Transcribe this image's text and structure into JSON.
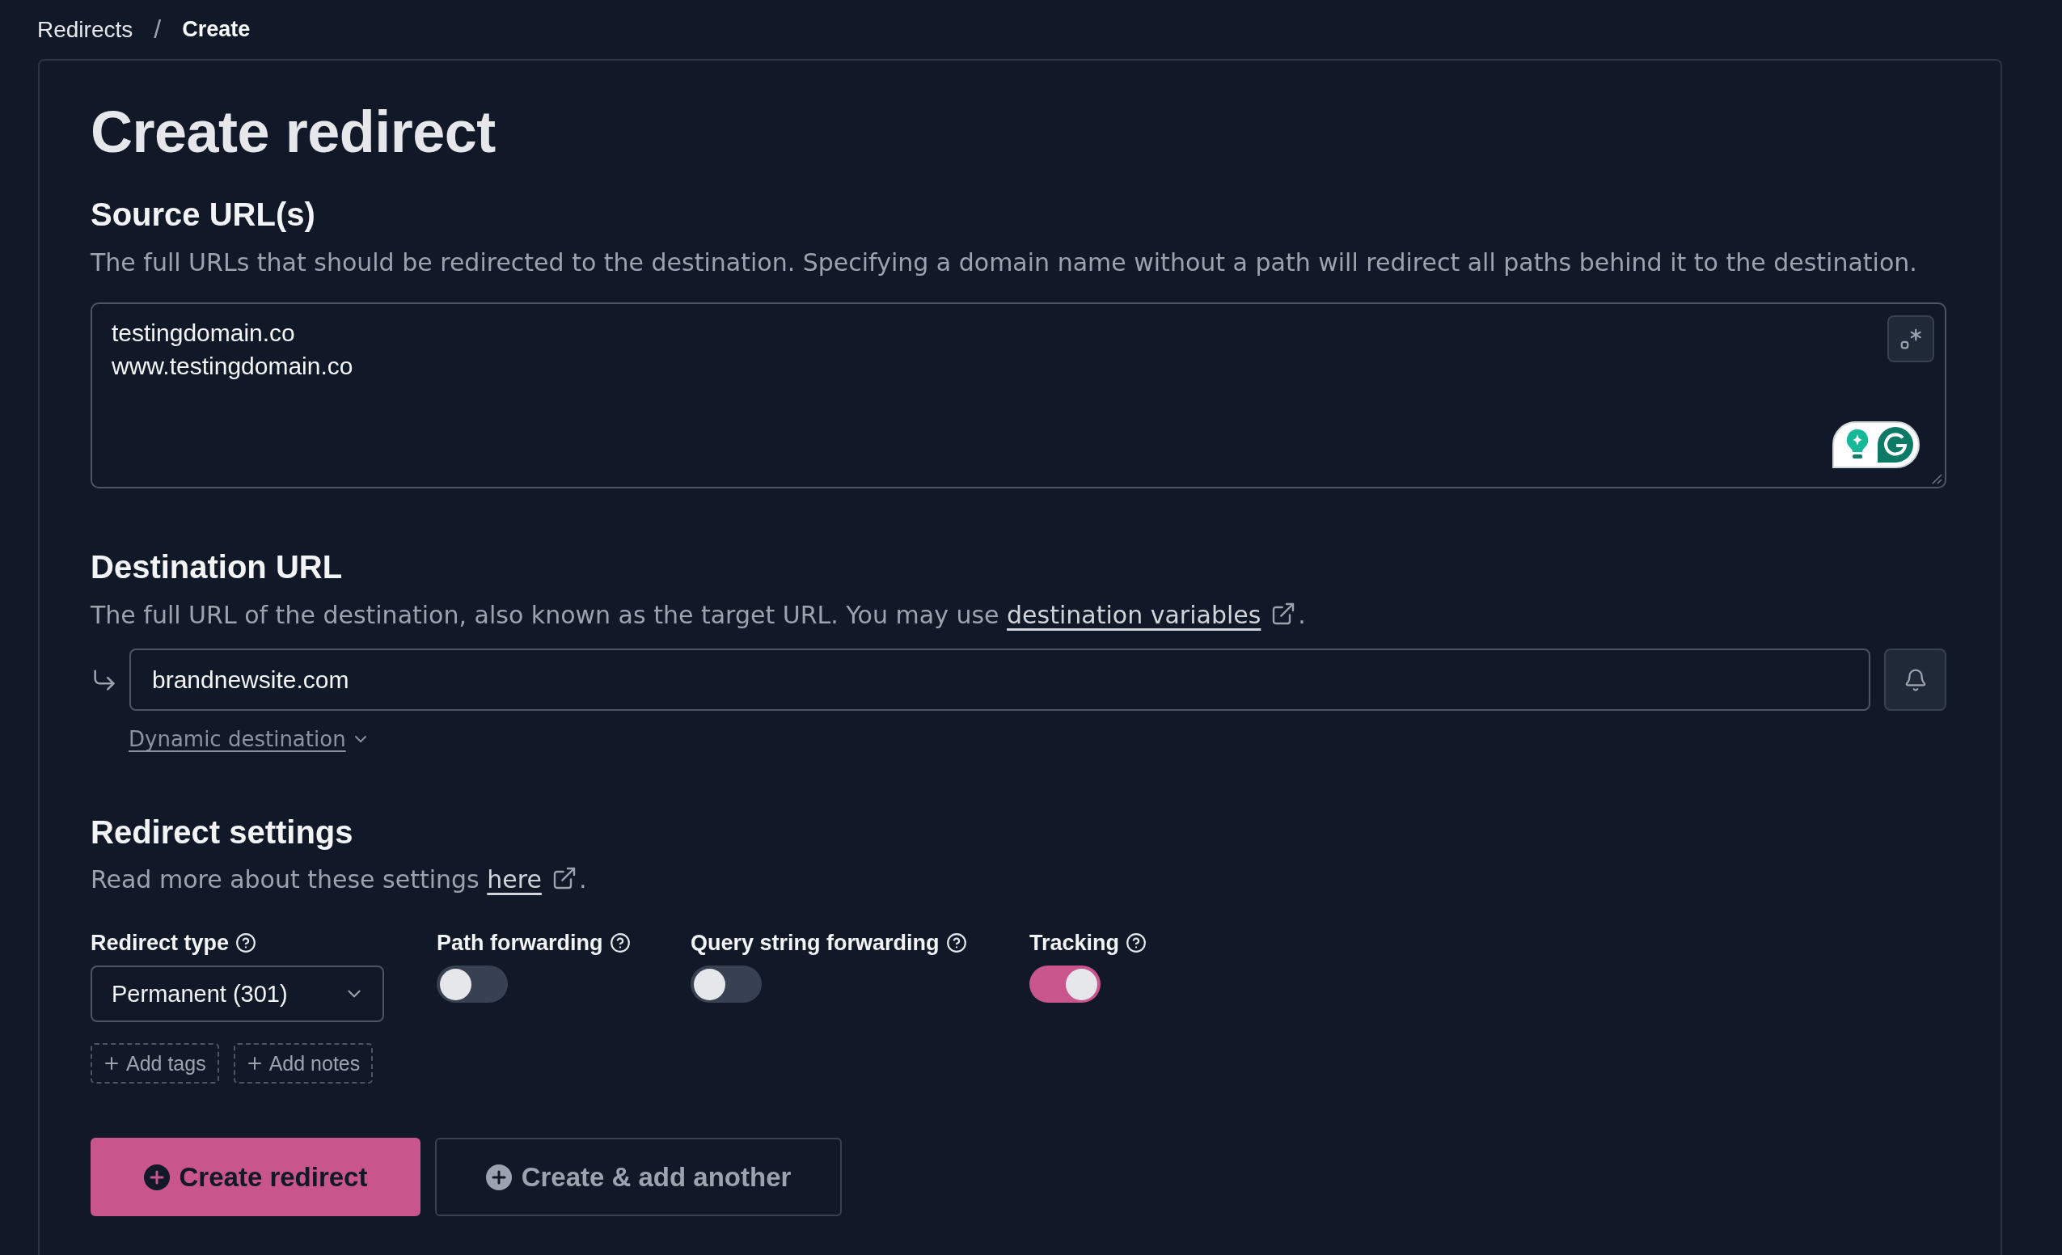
{
  "breadcrumb": {
    "items": [
      {
        "label": "Redirects",
        "current": false
      },
      {
        "label": "Create",
        "current": true
      }
    ],
    "separator": "/"
  },
  "page_title": "Create redirect",
  "source_urls": {
    "heading": "Source URL(s)",
    "description": "The full URLs that should be redirected to the destination. Specifying a domain name without a path will redirect all paths behind it to the destination.",
    "value": "testingdomain.co\nwww.testingdomain.co"
  },
  "destination": {
    "heading": "Destination URL",
    "description": {
      "text": "The full URL of the destination, also known as the target URL. You may use ",
      "link": "destination variables",
      "end": "."
    },
    "value": "brandnewsite.com",
    "dynamic": {
      "label": "Dynamic destination",
      "expanded": false
    }
  },
  "redirect_settings": {
    "heading": "Redirect settings",
    "description": {
      "text": "Read more about these settings ",
      "link": "here",
      "end": "."
    },
    "fields": [
      {
        "kind": "select",
        "label": "Redirect type",
        "value": "Permanent (301)"
      },
      {
        "kind": "toggle",
        "label": "Path forwarding",
        "on": false
      },
      {
        "kind": "toggle",
        "label": "Query string forwarding",
        "on": false
      },
      {
        "kind": "toggle",
        "label": "Tracking",
        "on": true
      }
    ],
    "extras": [
      "Add tags",
      "Add notes"
    ]
  },
  "actions": [
    {
      "label": "Create redirect",
      "kind": "primary"
    },
    {
      "label": "Create & add another",
      "kind": "secondary"
    }
  ]
}
